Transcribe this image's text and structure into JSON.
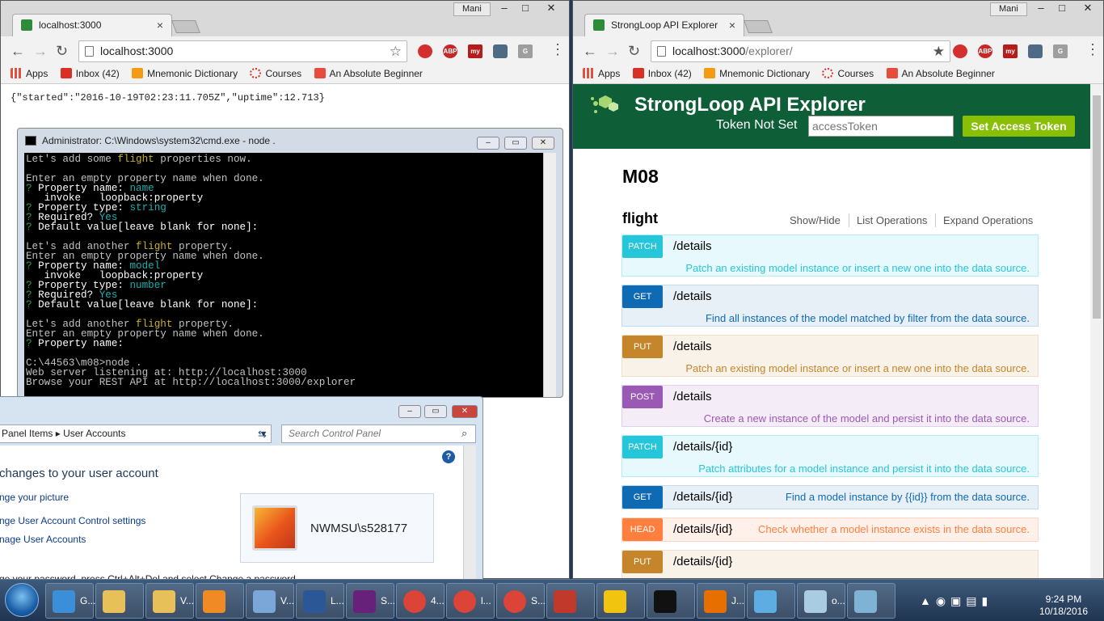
{
  "left_browser": {
    "tab_title": "localhost:3000",
    "user": "Mani",
    "url": "localhost:3000",
    "body_text": "{\"started\":\"2016-10-19T02:23:11.705Z\",\"uptime\":12.713}"
  },
  "right_browser": {
    "tab_title": "StrongLoop API Explorer",
    "user": "Mani",
    "url_host": "localhost:3000",
    "url_path": "/explorer/"
  },
  "bookmarks": [
    "Apps",
    "Inbox (42)",
    "Mnemonic Dictionary",
    "Courses",
    "An Absolute Beginner"
  ],
  "extensions": [
    "ABP",
    "my",
    "G"
  ],
  "cmd": {
    "title": "Administrator: C:\\Windows\\system32\\cmd.exe - node  .",
    "lines": [
      [
        {
          "t": "Let's add some ",
          "c": ""
        },
        {
          "t": "flight",
          "c": "yl"
        },
        {
          "t": " properties now.",
          "c": ""
        }
      ],
      [
        {
          "t": "",
          "c": ""
        }
      ],
      [
        {
          "t": "Enter an empty property name when done.",
          "c": ""
        }
      ],
      [
        {
          "t": "? ",
          "c": "gn"
        },
        {
          "t": "Property name: ",
          "c": "wh"
        },
        {
          "t": "name",
          "c": "cy"
        }
      ],
      [
        {
          "t": "   invoke   loopback:property",
          "c": "wh"
        }
      ],
      [
        {
          "t": "? ",
          "c": "gn"
        },
        {
          "t": "Property type: ",
          "c": "wh"
        },
        {
          "t": "string",
          "c": "cy"
        }
      ],
      [
        {
          "t": "? ",
          "c": "gn"
        },
        {
          "t": "Required? ",
          "c": "wh"
        },
        {
          "t": "Yes",
          "c": "cy"
        }
      ],
      [
        {
          "t": "? ",
          "c": "gn"
        },
        {
          "t": "Default value[leave blank for none]:",
          "c": "wh"
        }
      ],
      [
        {
          "t": "",
          "c": ""
        }
      ],
      [
        {
          "t": "Let's add another ",
          "c": ""
        },
        {
          "t": "flight",
          "c": "yl"
        },
        {
          "t": " property.",
          "c": ""
        }
      ],
      [
        {
          "t": "Enter an empty property name when done.",
          "c": ""
        }
      ],
      [
        {
          "t": "? ",
          "c": "gn"
        },
        {
          "t": "Property name: ",
          "c": "wh"
        },
        {
          "t": "model",
          "c": "cy"
        }
      ],
      [
        {
          "t": "   invoke   loopback:property",
          "c": "wh"
        }
      ],
      [
        {
          "t": "? ",
          "c": "gn"
        },
        {
          "t": "Property type: ",
          "c": "wh"
        },
        {
          "t": "number",
          "c": "cy"
        }
      ],
      [
        {
          "t": "? ",
          "c": "gn"
        },
        {
          "t": "Required? ",
          "c": "wh"
        },
        {
          "t": "Yes",
          "c": "cy"
        }
      ],
      [
        {
          "t": "? ",
          "c": "gn"
        },
        {
          "t": "Default value[leave blank for none]:",
          "c": "wh"
        }
      ],
      [
        {
          "t": "",
          "c": ""
        }
      ],
      [
        {
          "t": "Let's add another ",
          "c": ""
        },
        {
          "t": "flight",
          "c": "yl"
        },
        {
          "t": " property.",
          "c": ""
        }
      ],
      [
        {
          "t": "Enter an empty property name when done.",
          "c": ""
        }
      ],
      [
        {
          "t": "? ",
          "c": "gn"
        },
        {
          "t": "Property name:",
          "c": "wh"
        }
      ],
      [
        {
          "t": "",
          "c": ""
        }
      ],
      [
        {
          "t": "C:\\44563\\m08>node .",
          "c": ""
        }
      ],
      [
        {
          "t": "Web server listening at: http://localhost:3000",
          "c": ""
        }
      ],
      [
        {
          "t": "Browse your REST API at http://localhost:3000/explorer",
          "c": ""
        }
      ]
    ]
  },
  "control_panel": {
    "breadcrumb_1": "Panel Items",
    "breadcrumb_2": "User Accounts",
    "search_placeholder": "Search Control Panel",
    "heading": "changes to your user account",
    "links": [
      "nge your picture",
      "nge User Account Control settings",
      "nage User Accounts"
    ],
    "username": "NWMSU\\s528177",
    "bottom_text": "ge your password, press Ctrl+Alt+Del and select Change a password."
  },
  "explorer": {
    "title": "StrongLoop API Explorer",
    "token_label": "Token Not Set",
    "token_placeholder": "accessToken",
    "set_token_button": "Set Access Token",
    "resource": "M08",
    "model": "flight",
    "show_hide": "Show/Hide",
    "list_operations": "List Operations",
    "expand_operations": "Expand Operations",
    "operations": [
      {
        "method": "PATCH",
        "path": "/details",
        "desc": "Patch an existing model instance or insert a new one into the data source.",
        "color": "#26c6da",
        "bg": "#e7f9fc",
        "border": "#b3ecf3"
      },
      {
        "method": "GET",
        "path": "/details",
        "desc": "Find all instances of the model matched by filter from the data source.",
        "color": "#0f6ab4",
        "bg": "#e7f0f7",
        "border": "#c3d9ec"
      },
      {
        "method": "PUT",
        "path": "/details",
        "desc": "Patch an existing model instance or insert a new one into the data source.",
        "color": "#c5862b",
        "bg": "#f9f2e9",
        "border": "#f0e0ca"
      },
      {
        "method": "POST",
        "path": "/details",
        "desc": "Create a new instance of the model and persist it into the data source.",
        "color": "#9b59b6",
        "bg": "#f4ecf7",
        "border": "#e3cfeb"
      },
      {
        "method": "PATCH",
        "path": "/details/{id}",
        "desc": "Patch attributes for a model instance and persist it into the data source.",
        "color": "#26c6da",
        "bg": "#e7f9fc",
        "border": "#b3ecf3"
      },
      {
        "method": "GET",
        "path": "/details/{id}",
        "desc": "Find a model instance by {{id}} from the data source.",
        "color": "#0f6ab4",
        "bg": "#e7f0f7",
        "border": "#c3d9ec"
      },
      {
        "method": "HEAD",
        "path": "/details/{id}",
        "desc": "Check whether a model instance exists in the data source.",
        "color": "#ff7f3f",
        "bg": "#fff1ea",
        "border": "#ffd6c2"
      },
      {
        "method": "PUT",
        "path": "/details/{id}",
        "desc": "",
        "color": "#c5862b",
        "bg": "#f9f2e9",
        "border": "#f0e0ca"
      }
    ]
  },
  "taskbar": {
    "items": [
      {
        "label": "G...",
        "icon": "ie-icon",
        "color": "#3b8fd8"
      },
      {
        "label": "",
        "icon": "folder-icon",
        "color": "#e8c05a"
      },
      {
        "label": "V...",
        "icon": "folder-icon",
        "color": "#e8c05a"
      },
      {
        "label": "",
        "icon": "media-player-icon",
        "color": "#f08a24"
      },
      {
        "label": "V...",
        "icon": "virtualbox-icon",
        "color": "#7aa7d8"
      },
      {
        "label": "L...",
        "icon": "word-icon",
        "color": "#2b5797"
      },
      {
        "label": "S...",
        "icon": "visual-studio-icon",
        "color": "#68217a"
      },
      {
        "label": "4...",
        "icon": "chrome-icon",
        "color": "#db4437"
      },
      {
        "label": "l...",
        "icon": "chrome-icon",
        "color": "#db4437"
      },
      {
        "label": "S...",
        "icon": "chrome-icon",
        "color": "#db4437"
      },
      {
        "label": "",
        "icon": "snipping-tool-icon",
        "color": "#c0392b"
      },
      {
        "label": "",
        "icon": "git-icon",
        "color": "#f1c40f"
      },
      {
        "label": "",
        "icon": "cmd-icon",
        "color": "#111111"
      },
      {
        "label": "J...",
        "icon": "java-icon",
        "color": "#e76f00"
      },
      {
        "label": "",
        "icon": "network-icon",
        "color": "#5dade2"
      },
      {
        "label": "o...",
        "icon": "notepad-icon",
        "color": "#a9cce3"
      },
      {
        "label": "",
        "icon": "users-icon",
        "color": "#7fb3d5"
      }
    ],
    "time": "9:24 PM",
    "date": "10/18/2016"
  }
}
